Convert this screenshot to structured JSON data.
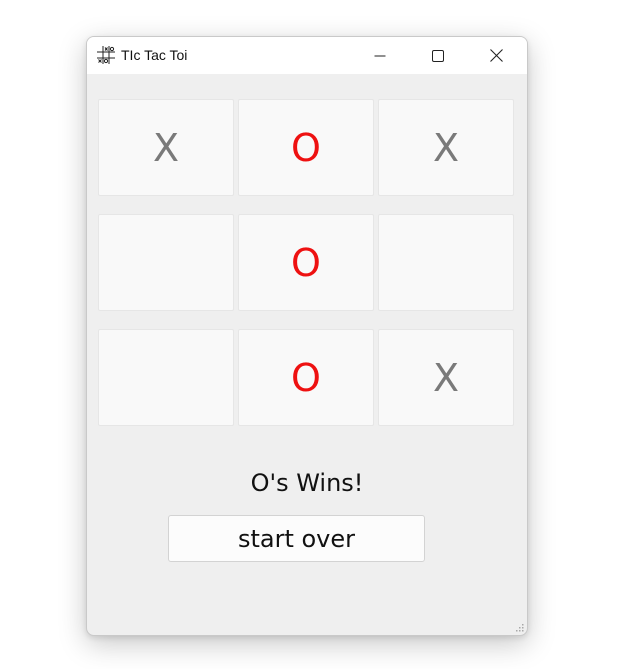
{
  "window": {
    "title": "TIc Tac Toi",
    "icon": "tic-tac-toe-grid-icon",
    "controls": [
      "minimize-icon",
      "maximize-icon",
      "close-icon"
    ]
  },
  "board": {
    "cells": [
      "X",
      "O",
      "X",
      "",
      "O",
      "",
      "",
      "O",
      "X"
    ]
  },
  "status_text": "O's Wins!",
  "start_over_label": "start over",
  "colors": {
    "x_mark": "#7a7a7a",
    "o_mark": "#ee1111",
    "window_bg": "#efefef",
    "cell_bg": "#f9f9f9"
  }
}
